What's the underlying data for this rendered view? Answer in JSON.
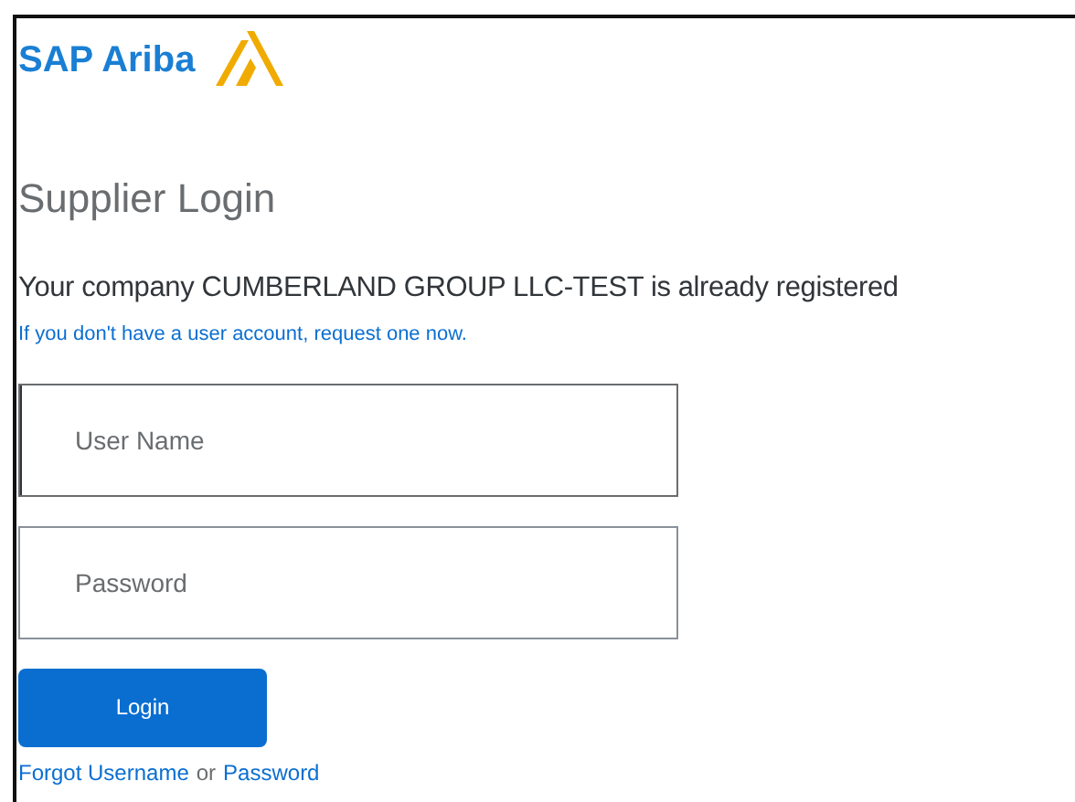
{
  "logo": {
    "text": "SAP Ariba"
  },
  "title": "Supplier Login",
  "message": "Your company CUMBERLAND GROUP LLC-TEST is already registered",
  "request_link": "If you don't have a user account, request one now.",
  "fields": [
    {
      "placeholder": "User Name",
      "focused": true
    },
    {
      "placeholder": "Password",
      "focused": false
    }
  ],
  "login_button": "Login",
  "forgot": {
    "username_link": "Forgot Username",
    "separator": "or",
    "password_link": "Password"
  }
}
